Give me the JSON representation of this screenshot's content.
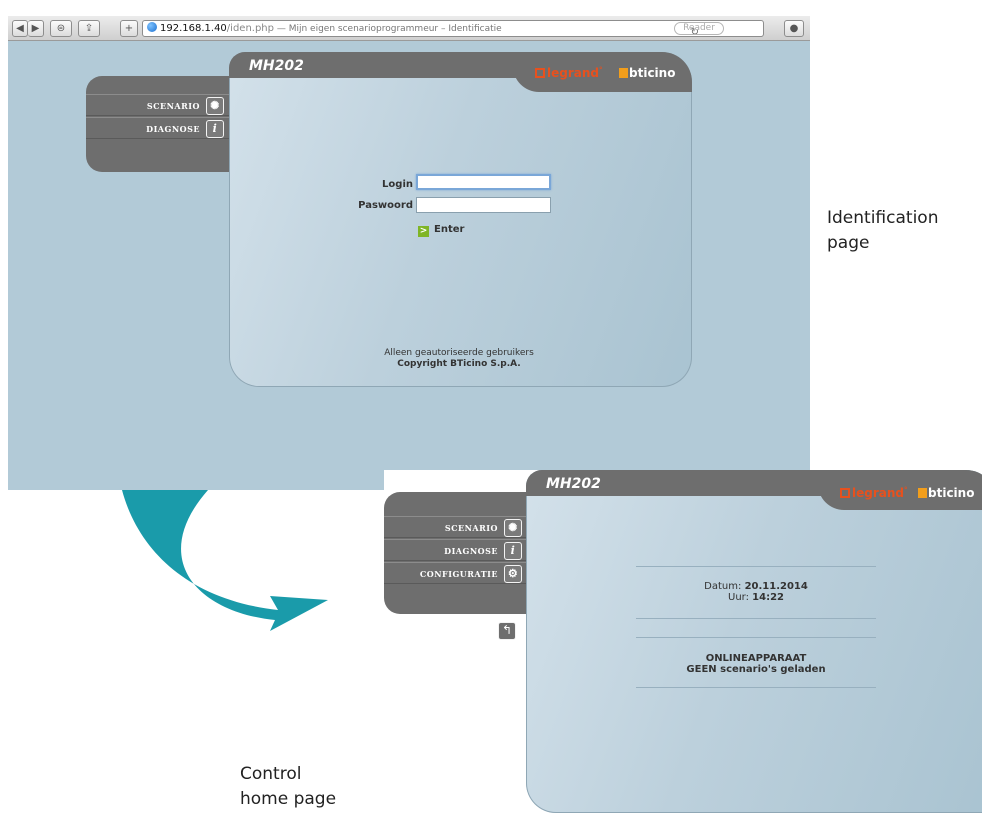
{
  "browser": {
    "url_host": "192.168.1.40",
    "url_path": "/iden.php",
    "page_title": " — Mijn eigen scenarioprogrammeur – Identificatie",
    "reader_label": "Reader",
    "reload_icon": "reload-icon"
  },
  "brand": {
    "product": "MH202",
    "logo_legrand": "legrand",
    "logo_bticino": "bticino",
    "colors": {
      "legrand": "#e7511e",
      "bticino_accent": "#f29e1c",
      "chrome": "#6e6e6e",
      "page_bg": "#b2cad7"
    }
  },
  "login_page": {
    "menu": [
      {
        "label": "SCENARIO",
        "icon": "scenario-icon"
      },
      {
        "label": "DIAGNOSE",
        "icon": "info-icon"
      }
    ],
    "login_label": "Login",
    "login_value": "",
    "password_label": "Paswoord",
    "password_value": "",
    "enter_label": "Enter",
    "footer_line1": "Alleen geautoriseerde gebruikers",
    "footer_line2": "Copyright BTicino S.p.A."
  },
  "control_page": {
    "menu": [
      {
        "label": "SCENARIO",
        "icon": "scenario-icon"
      },
      {
        "label": "DIAGNOSE",
        "icon": "info-icon"
      },
      {
        "label": "CONFIGURATIE",
        "icon": "gear-icon"
      }
    ],
    "date_label": "Datum:",
    "date_value": "20.11.2014",
    "time_label": "Uur:",
    "time_value": "14:22",
    "status_line1": "ONLINEAPPARAAT",
    "status_line2": "GEEN scenario's geladen"
  },
  "captions": {
    "identification_line1": "Identification",
    "identification_line2": "page",
    "control_line1": "Control",
    "control_line2": "home page"
  }
}
